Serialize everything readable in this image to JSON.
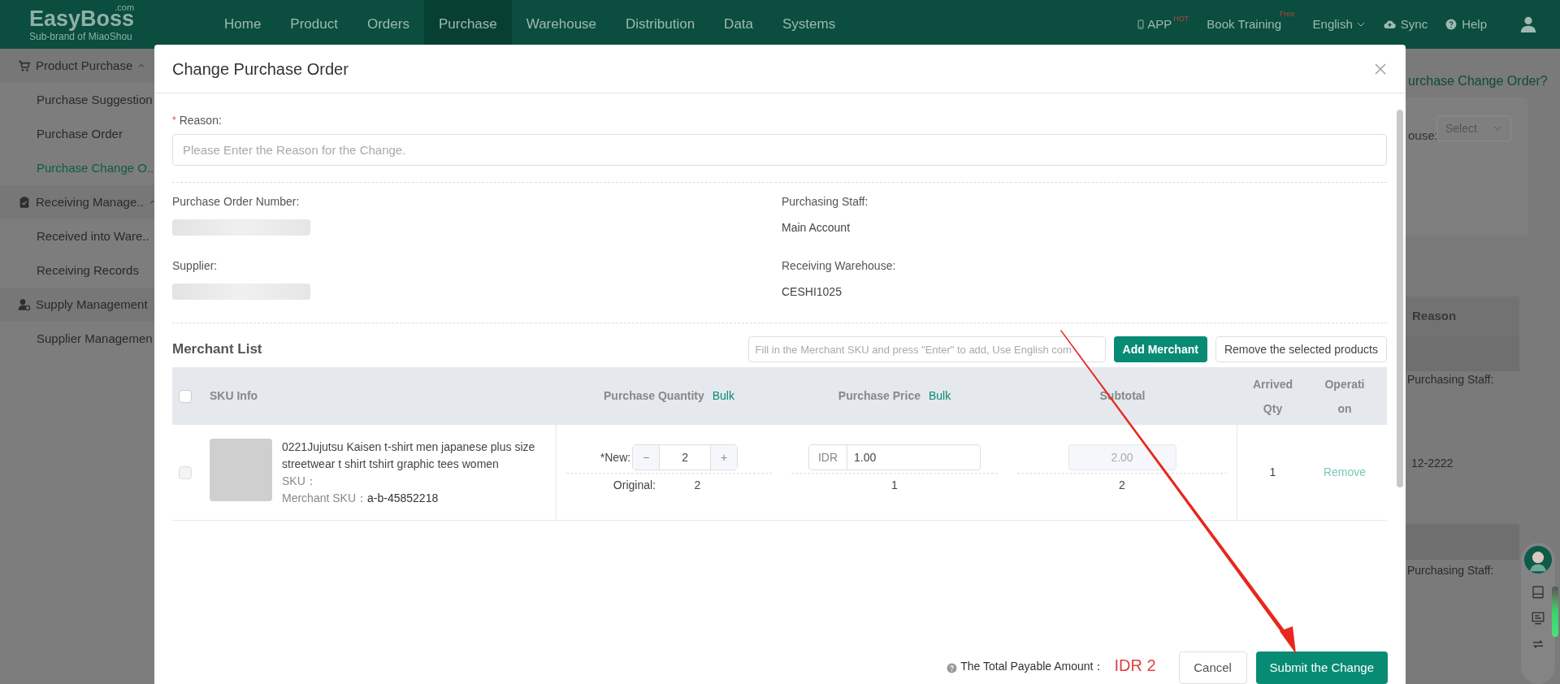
{
  "nav": {
    "logo": "EasyBoss",
    "logo_sup": ".com",
    "tagline": "Sub-brand of MiaoShou",
    "items": [
      {
        "label": "Home",
        "selected": false
      },
      {
        "label": "Product",
        "selected": false
      },
      {
        "label": "Orders",
        "selected": false
      },
      {
        "label": "Purchase",
        "selected": true
      },
      {
        "label": "Warehouse",
        "selected": false
      },
      {
        "label": "Distribution",
        "selected": false
      },
      {
        "label": "Data",
        "selected": false
      },
      {
        "label": "Systems",
        "selected": false
      }
    ],
    "app": {
      "label": "APP",
      "badge": "HOT"
    },
    "training": {
      "label": "Book Training",
      "badge": "Free"
    },
    "language": "English",
    "sync": "Sync",
    "help": "Help"
  },
  "sidebar": {
    "groups": [
      {
        "label": "Product Purchase",
        "children": [
          {
            "label": "Purchase Suggestion",
            "selected": false
          },
          {
            "label": "Purchase Order",
            "selected": false
          },
          {
            "label": "Purchase Change O..",
            "selected": true
          }
        ]
      },
      {
        "label": "Receiving Manage..",
        "children": [
          {
            "label": "Received into Ware..",
            "selected": false
          },
          {
            "label": "Receiving Records",
            "selected": false
          }
        ]
      },
      {
        "label": "Supply Management",
        "children": [
          {
            "label": "Supplier Managemen",
            "selected": false
          }
        ]
      }
    ]
  },
  "background_page": {
    "link": "urchase Change Order?",
    "filter_label": "ouse:",
    "filter_placeholder": "Select",
    "table_header": "Reason",
    "cells": [
      "Purchasing Staff:",
      "12-2222",
      "Purchasing Staff:"
    ]
  },
  "dialog": {
    "title": "Change Purchase Order",
    "reason": {
      "required_mark": "*",
      "label": "Reason:",
      "placeholder": "Please Enter the Reason for the Change."
    },
    "fields": [
      {
        "label": "Purchase Order Number:",
        "blurred": true
      },
      {
        "label": "Purchasing Staff:",
        "value": "Main Account"
      },
      {
        "label": "Supplier:",
        "blurred": true
      },
      {
        "label": "Receiving Warehouse:",
        "value": "CESHI1025"
      }
    ],
    "merchant_list": {
      "title": "Merchant List",
      "search_placeholder": "Fill in the Merchant SKU and press \"Enter\" to add, Use English com",
      "add_button": "Add Merchant",
      "remove_button": "Remove the selected products",
      "columns": [
        {
          "label": "SKU Info"
        },
        {
          "label": "Purchase Quantity",
          "bulk": "Bulk"
        },
        {
          "label": "Purchase Price",
          "bulk": "Bulk"
        },
        {
          "label": "Subtotal"
        },
        {
          "label": "Arrived Qty"
        },
        {
          "label": "Operation"
        }
      ],
      "header_checked": false,
      "rows": [
        {
          "checked": false,
          "title": "0221Jujutsu Kaisen t-shirt men japanese plus size streetwear t shirt tshirt graphic tees women",
          "sku_label": "SKU：",
          "merchant_sku_label": "Merchant SKU：",
          "merchant_sku": "a-b-45852218",
          "new_label": "*New:",
          "qty_minus": "−",
          "quantity": "2",
          "qty_plus": "+",
          "original_label": "Original:",
          "original_qty": "2",
          "currency": "IDR",
          "price": "1.00",
          "original_price": "1",
          "subtotal": "2.00",
          "original_subtotal": "2",
          "arrived": "1",
          "operation": "Remove"
        }
      ]
    },
    "total_label": "The Total Payable Amount：",
    "total": "IDR 2",
    "cancel": "Cancel",
    "submit": "Submit the Change"
  }
}
